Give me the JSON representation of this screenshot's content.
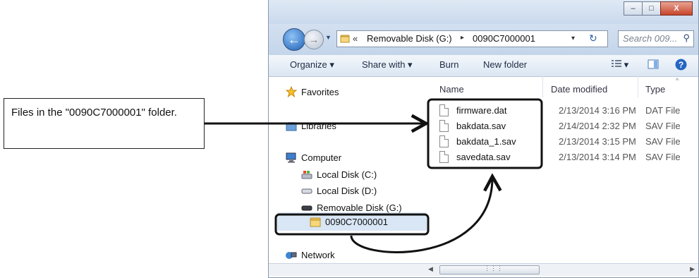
{
  "callout": {
    "text": "Files in the \"0090C7000001\" folder."
  },
  "window": {
    "minimize": "–",
    "maximize": "□",
    "close": "X"
  },
  "address_bar": {
    "chevron": "«",
    "segment1": "Removable Disk (G:)",
    "separator": "▸",
    "segment2": "0090C7000001",
    "dropdown": "▾"
  },
  "search": {
    "placeholder": "Search 009..."
  },
  "toolbar": {
    "organize": "Organize ▾",
    "share_with": "Share with ▾",
    "burn": "Burn",
    "new_folder": "New folder",
    "view": "▾"
  },
  "nav_pane": {
    "favorites": "Favorites",
    "libraries": "Libraries",
    "computer": "Computer",
    "local_c": "Local Disk (C:)",
    "local_d": "Local Disk (D:)",
    "removable": "Removable Disk (G:)",
    "folder": "0090C7000001",
    "network": "Network"
  },
  "columns": {
    "name": "Name",
    "date_modified": "Date modified",
    "type": "Type"
  },
  "files": [
    {
      "name": "firmware.dat",
      "date": "2/13/2014 3:16 PM",
      "type": "DAT File"
    },
    {
      "name": "bakdata.sav",
      "date": "2/14/2014 2:32 PM",
      "type": "SAV File"
    },
    {
      "name": "bakdata_1.sav",
      "date": "2/13/2014 3:15 PM",
      "type": "SAV File"
    },
    {
      "name": "savedata.sav",
      "date": "2/13/2014 3:14 PM",
      "type": "SAV File"
    }
  ],
  "icons": {
    "star": "favorites-star-icon",
    "library": "libraries-icon",
    "computer": "computer-icon",
    "drive": "drive-icon",
    "folder": "folder-icon",
    "network": "network-icon",
    "file": "file-icon"
  },
  "colors": {
    "selection": "#d8e6f5",
    "chrome": "#c9d9ec",
    "highlight_border": "#1a1a1a"
  }
}
